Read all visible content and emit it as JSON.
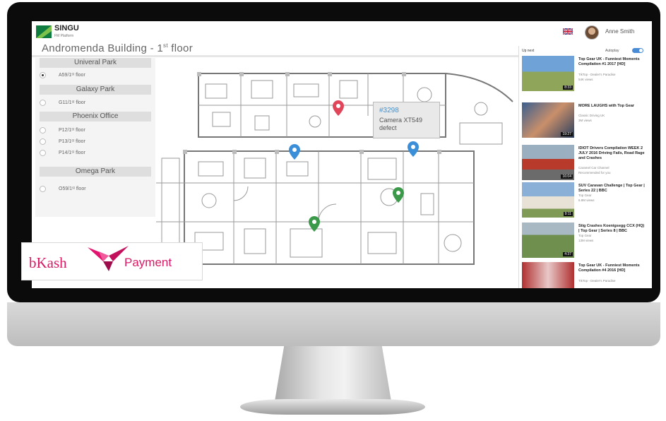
{
  "app": {
    "logo_text": "SINGU",
    "logo_sub": "FM Platform",
    "user_name": "Anne Smith",
    "building_title": "Andromenda Building - 1",
    "floor_suffix": "st",
    "floor_word": " floor"
  },
  "sidebar": {
    "groups": [
      {
        "name": "Univeral Park",
        "items": [
          {
            "label": "A59/1ˢᵗ floor",
            "selected": true
          }
        ]
      },
      {
        "name": "Galaxy Park",
        "items": [
          {
            "label": "G11/1ˢᵗ floor",
            "selected": false
          }
        ]
      },
      {
        "name": "Phoenix Office",
        "items": [
          {
            "label": "P12/1ˢᵗ floor",
            "selected": false
          },
          {
            "label": "P13/1ˢᵗ floor",
            "selected": false
          },
          {
            "label": "P14/1ˢᵗ floor",
            "selected": false
          }
        ]
      },
      {
        "name": "Omega Park",
        "items": [
          {
            "label": "O59/1ˢᵗ floor",
            "selected": false
          }
        ]
      }
    ]
  },
  "tooltip": {
    "id": "#3298",
    "text": "Camera XT549 defect"
  },
  "pins": [
    {
      "name": "red-pin",
      "color": "#e0455a"
    },
    {
      "name": "blue-pin-1",
      "color": "#3a8fd8"
    },
    {
      "name": "blue-pin-2",
      "color": "#3a8fd8"
    },
    {
      "name": "green-pin-1",
      "color": "#3a9a4a"
    },
    {
      "name": "green-pin-2",
      "color": "#3a9a4a"
    }
  ],
  "bkash": {
    "name": "bKash",
    "payment": "Payment",
    "brand_color": "#d81a65"
  },
  "videos": {
    "up_next": "Up next",
    "autoplay": "Autoplay",
    "items": [
      {
        "title": "Top Gear UK - Funniest Moments Compilation #1 2017 [HD]",
        "channel": "TikTop - Dealer's Paradise",
        "views": "54K views",
        "duration": "8:33"
      },
      {
        "title": "MORE LAUGHS with Top Gear",
        "channel": "Classic Driving UK",
        "views": "3M views",
        "duration": "19:27"
      },
      {
        "title": "IDIOT Drivers Compilation WEEK 2 JULY 2016 Driving Fails, Road Rage and Crashes",
        "channel": "Caramel Car Channel",
        "views": "Recommended for you",
        "duration": "16:04"
      },
      {
        "title": "SUV Caravan Challenge | Top Gear | Series 22 | BBC",
        "channel": "Top Gear",
        "views": "6.8M views",
        "duration": "9:11"
      },
      {
        "title": "Stig Crashes Koenigsegg CCX (HQ) | Top Gear | Series 8 | BBC",
        "channel": "Top Gear",
        "views": "13M views",
        "duration": "4:37"
      },
      {
        "title": "Top Gear UK - Funniest Moments Compilation #4 2016 [HD]",
        "channel": "TikTop - Dealer's Paradise",
        "views": "",
        "duration": ""
      }
    ]
  }
}
